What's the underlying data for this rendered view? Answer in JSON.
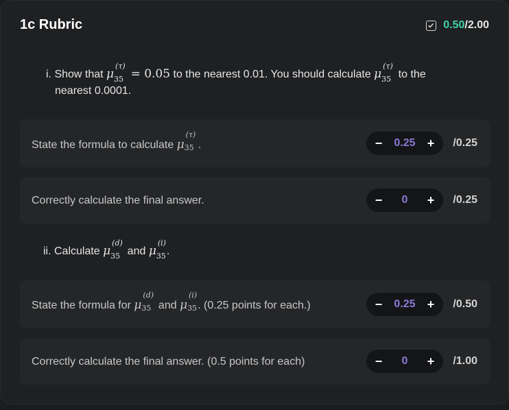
{
  "header": {
    "title": "1c Rubric",
    "score_earned": "0.50",
    "score_total": "/2.00"
  },
  "part_i": {
    "prefix": "i. Show that ",
    "equals": "= 0.05",
    "mid": " to the nearest 0.01. You should calculate ",
    "suffix": " to the",
    "line2": "nearest 0.0001.",
    "sup_tau": "(τ)",
    "sub_35": "35"
  },
  "part_ii": {
    "prefix": "ii. Calculate ",
    "and": " and ",
    "suffix": ".",
    "sup_d": "(d)",
    "sup_i": "(i)",
    "sub_35": "35"
  },
  "criteria": [
    {
      "text_prefix": "State the formula to calculate ",
      "text_suffix": ".",
      "value": "0.25",
      "max": "/0.25"
    },
    {
      "text": "Correctly calculate the final answer.",
      "value": "0",
      "max": "/0.25"
    },
    {
      "text_prefix": "State the formula for ",
      "text_and": " and ",
      "text_suffix": ". (0.25 points for each.)",
      "value": "0.25",
      "max": "/0.50"
    },
    {
      "text": "Correctly calculate the final answer. (0.5 points for each)",
      "value": "0",
      "max": "/1.00"
    }
  ],
  "stepper": {
    "minus": "−",
    "plus": "+"
  },
  "colors": {
    "accent_green": "#3fd3a6",
    "value_purple": "#8b7ad8",
    "card_bg": "#252628"
  },
  "icons": {
    "score_check": "checkbox-checked-icon"
  }
}
